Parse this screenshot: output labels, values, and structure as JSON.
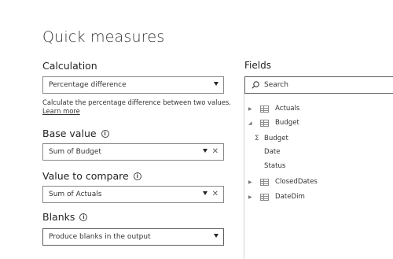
{
  "title": "Quick measures",
  "calculation": {
    "label": "Calculation",
    "selected": "Percentage difference",
    "description": "Calculate the percentage difference between two values.",
    "learn_more": "Learn more"
  },
  "base_value": {
    "label": "Base value",
    "value": "Sum of Budget"
  },
  "value_to_compare": {
    "label": "Value to compare",
    "value": "Sum of Actuals"
  },
  "blanks": {
    "label": "Blanks",
    "selected": "Produce blanks in the output"
  },
  "fields": {
    "title": "Fields",
    "search_placeholder": "Search",
    "tables": [
      {
        "name": "Actuals",
        "expanded": false
      },
      {
        "name": "Budget",
        "expanded": true,
        "children": [
          "Budget",
          "Date",
          "Status"
        ]
      },
      {
        "name": "ClosedDates",
        "expanded": false
      },
      {
        "name": "DateDim",
        "expanded": false
      }
    ]
  },
  "icons": {
    "info": "info-icon",
    "search": "search-icon",
    "table": "table-icon",
    "sigma": "sigma-icon",
    "close": "close-icon",
    "chevron": "chevron-down-icon"
  }
}
